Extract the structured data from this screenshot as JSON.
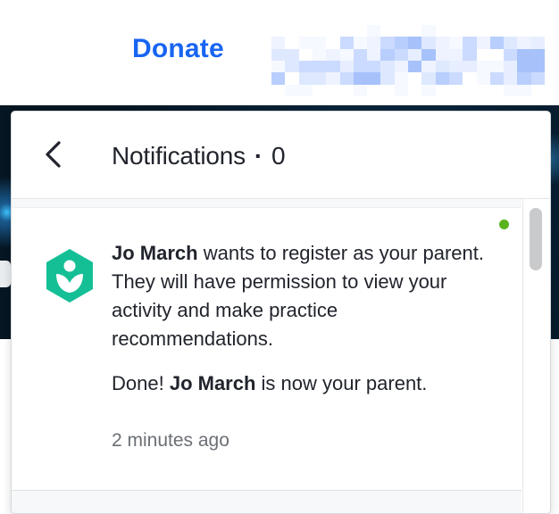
{
  "header": {
    "donate_label": "Donate",
    "account_blurred": true
  },
  "notifications_panel": {
    "title": "Notifications",
    "separator": "·",
    "count": "0",
    "items": [
      {
        "unread": true,
        "requester_name": "Jo March",
        "message": " wants to register as your parent. They will have permission to view your activity and make practice recommendations.",
        "status_prefix": "Done! ",
        "status_name": "Jo March",
        "status_suffix": " is now your parent.",
        "timestamp": "2 minutes ago"
      }
    ]
  },
  "icons": {
    "back": "chevron-left-icon",
    "logo": "khan-academy-logo-icon"
  },
  "colors": {
    "donate": "#1865f2",
    "logo": "#14bf96",
    "unread_dot": "#5ab31c",
    "text": "#21242c",
    "muted_text": "#6b6f75"
  }
}
